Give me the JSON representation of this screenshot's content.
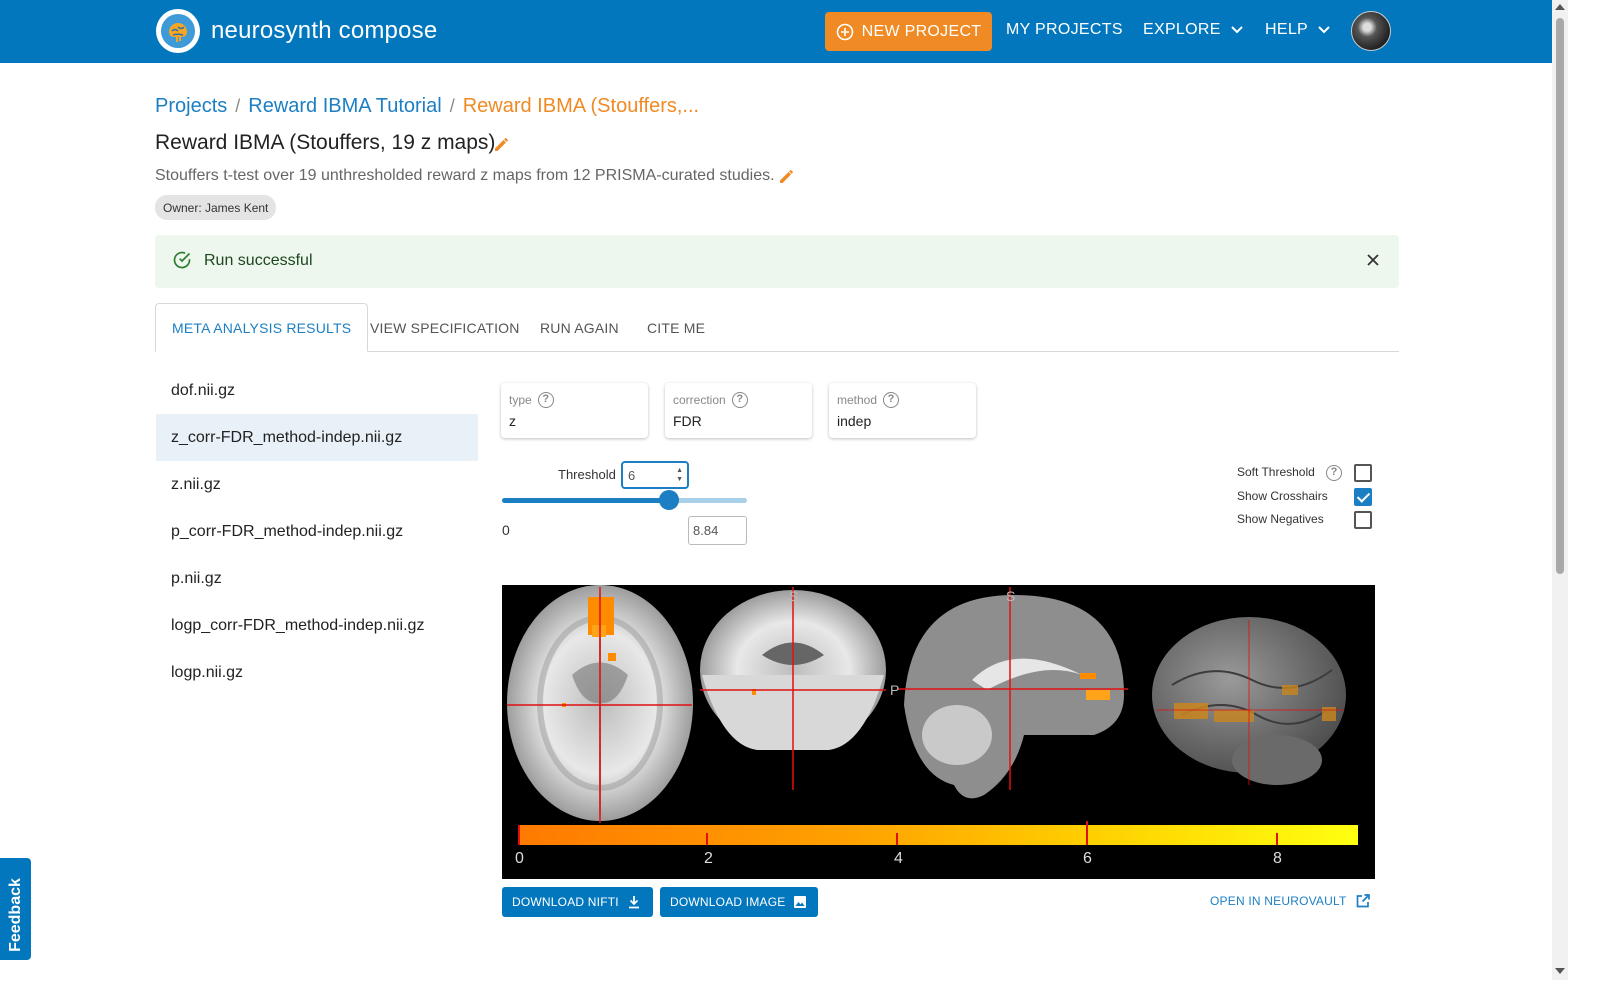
{
  "header": {
    "brand": "neurosynth compose",
    "new_project": "NEW PROJECT",
    "my_projects": "MY PROJECTS",
    "explore": "EXPLORE",
    "help": "HELP"
  },
  "breadcrumb": {
    "projects": "Projects",
    "project": "Reward IBMA Tutorial",
    "current": "Reward IBMA (Stouffers,..."
  },
  "meta": {
    "title": "Reward IBMA (Stouffers, 19 z maps)",
    "description": "Stouffers t-test over 19 unthresholded reward z maps from 12 PRISMA-curated studies.",
    "owner": "Owner: James Kent"
  },
  "alert": {
    "text": "Run successful",
    "color": "#edf7ed"
  },
  "tabs": [
    "META ANALYSIS RESULTS",
    "VIEW SPECIFICATION",
    "RUN AGAIN",
    "CITE ME"
  ],
  "files": [
    "dof.nii.gz",
    "z_corr-FDR_method-indep.nii.gz",
    "z.nii.gz",
    "p_corr-FDR_method-indep.nii.gz",
    "p.nii.gz",
    "logp_corr-FDR_method-indep.nii.gz",
    "logp.nii.gz"
  ],
  "selected_file_index": 1,
  "filters": [
    {
      "label": "type",
      "value": "z"
    },
    {
      "label": "correction",
      "value": "FDR"
    },
    {
      "label": "method",
      "value": "indep"
    }
  ],
  "threshold": {
    "label": "Threshold",
    "value": "6",
    "min_label": "0",
    "max_value": "8.84",
    "fraction": 0.68
  },
  "options": [
    {
      "label": "Soft Threshold",
      "checked": false,
      "help": true
    },
    {
      "label": "Show Crosshairs",
      "checked": true,
      "help": false
    },
    {
      "label": "Show Negatives",
      "checked": false,
      "help": false
    }
  ],
  "viewer": {
    "colorbar_ticks": [
      "0",
      "2",
      "4",
      "6",
      "8"
    ],
    "orientation_labels": [
      "S",
      "S",
      "P"
    ]
  },
  "actions": {
    "download_nifti": "DOWNLOAD NIFTI",
    "download_image": "DOWNLOAD IMAGE",
    "open_neurovault": "OPEN IN NEUROVAULT"
  },
  "feedback": "Feedback",
  "colors": {
    "primary": "#0277bd",
    "accent": "#f08a24",
    "link": "#1c7fc4"
  }
}
